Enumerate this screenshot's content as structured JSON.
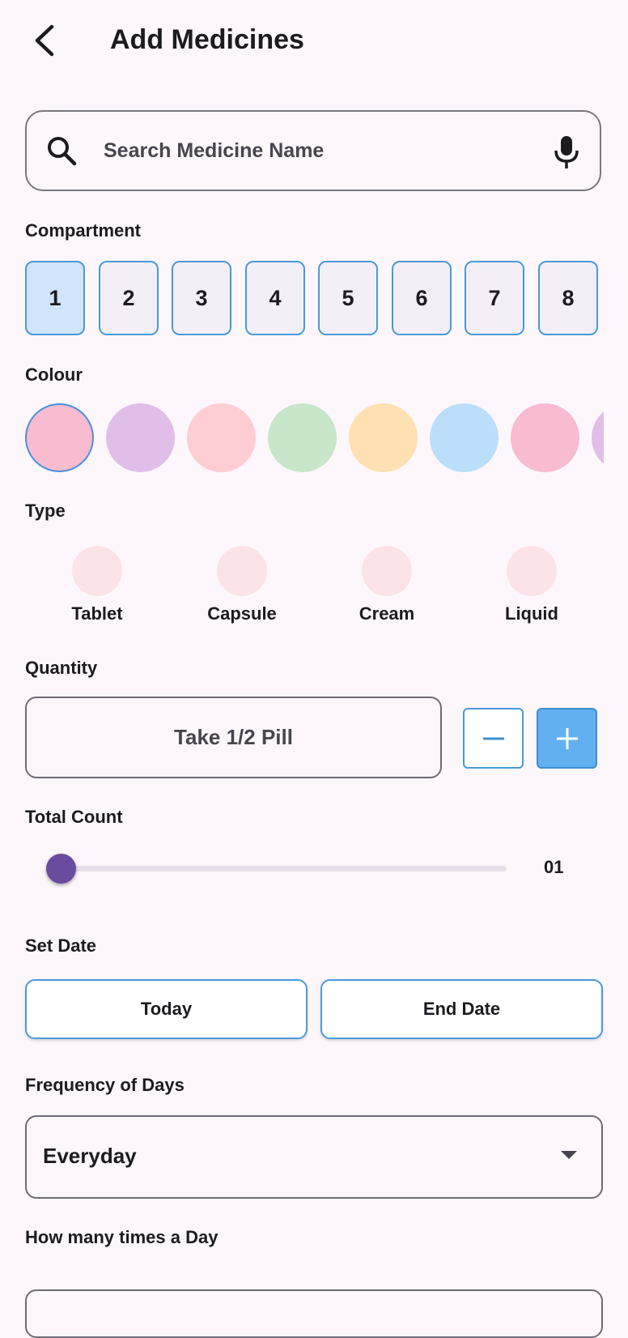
{
  "header": {
    "title": "Add Medicines",
    "back_icon": "arrow-back-icon"
  },
  "search": {
    "placeholder": "Search Medicine Name",
    "value": "",
    "search_icon": "search-icon",
    "mic_icon": "mic-icon"
  },
  "compartment": {
    "label": "Compartment",
    "items": [
      "1",
      "2",
      "3",
      "4",
      "5",
      "6",
      "7",
      "8"
    ],
    "selected": "1"
  },
  "colour": {
    "label": "Colour",
    "swatches": [
      "#f8bbd0",
      "#e1bee7",
      "#ffcdd2",
      "#c8e6c9",
      "#ffe0b2",
      "#bbdefb",
      "#f8bbd0",
      "#e1bee7"
    ],
    "selected_index": 0
  },
  "type": {
    "label": "Type",
    "items": [
      "Tablet",
      "Capsule",
      "Cream",
      "Liquid"
    ]
  },
  "quantity": {
    "label": "Quantity",
    "value": "Take 1/2 Pill",
    "minus_icon": "minus-icon",
    "plus_icon": "plus-icon"
  },
  "total_count": {
    "label": "Total Count",
    "value": "01",
    "slider_fraction": 0
  },
  "set_date": {
    "label": "Set Date",
    "start_label": "Today",
    "end_label": "End Date"
  },
  "frequency": {
    "label": "Frequency of Days",
    "value": "Everyday",
    "caret_icon": "dropdown-caret-icon"
  },
  "times_per_day": {
    "label": "How many times a Day"
  },
  "colors": {
    "accent_border": "#4a9ad8",
    "plus_fill": "#62b0f1",
    "slider_thumb": "#6a4c9e",
    "selected_compartment": "#d0e4fb"
  }
}
